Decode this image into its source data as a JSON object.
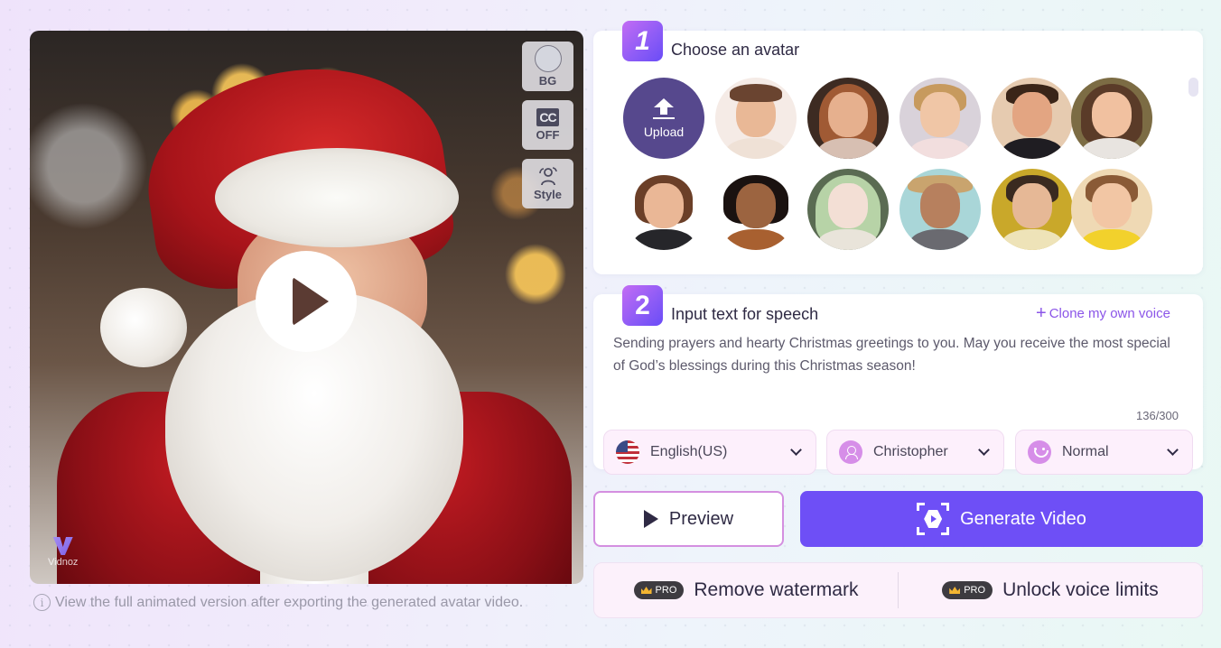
{
  "preview": {
    "tools": [
      {
        "name": "bg",
        "label": "BG"
      },
      {
        "name": "cc",
        "icon_text": "CC",
        "label": "OFF"
      },
      {
        "name": "style",
        "label": "Style"
      }
    ],
    "watermark": "Vidnoz",
    "note": "View the full animated version after exporting the generated avatar video."
  },
  "step1": {
    "number": "1",
    "title": "Choose an avatar",
    "upload_label": "Upload",
    "avatars": [
      {
        "id": "avatar-1",
        "desc": "cartoon man brown hair"
      },
      {
        "id": "avatar-2",
        "desc": "cartoon woman long auburn hair"
      },
      {
        "id": "avatar-3",
        "desc": "cartoon woman blonde bun"
      },
      {
        "id": "avatar-4",
        "desc": "cartoon man black hoodie"
      },
      {
        "id": "avatar-5",
        "desc": "cartoon girl wavy hair"
      },
      {
        "id": "avatar-6",
        "desc": "cartoon woman with book"
      },
      {
        "id": "avatar-7",
        "desc": "cartoon woman glasses curly hair"
      },
      {
        "id": "avatar-8",
        "desc": "anime girl green hair"
      },
      {
        "id": "avatar-9",
        "desc": "man straw hat"
      },
      {
        "id": "avatar-10",
        "desc": "woman sunflowers"
      },
      {
        "id": "avatar-11",
        "desc": "cartoon girl yellow shirt"
      }
    ]
  },
  "step2": {
    "number": "2",
    "title": "Input text for speech",
    "clone_link": "Clone my own voice",
    "text": "Sending prayers and hearty Christmas greetings to you. May you receive the most special of God’s blessings during this Christmas season!",
    "counter": "136/300",
    "language": "English(US)",
    "voice": "Christopher",
    "emotion": "Normal"
  },
  "actions": {
    "preview_label": "Preview",
    "generate_label": "Generate Video"
  },
  "pro": {
    "badge": "PRO",
    "remove_watermark": "Remove watermark",
    "unlock_voice": "Unlock voice limits"
  },
  "colors": {
    "accent": "#6e4ff6",
    "upload_bg": "#56488d",
    "link": "#8b55e8",
    "dropdown_bg": "#fdf0fc"
  }
}
